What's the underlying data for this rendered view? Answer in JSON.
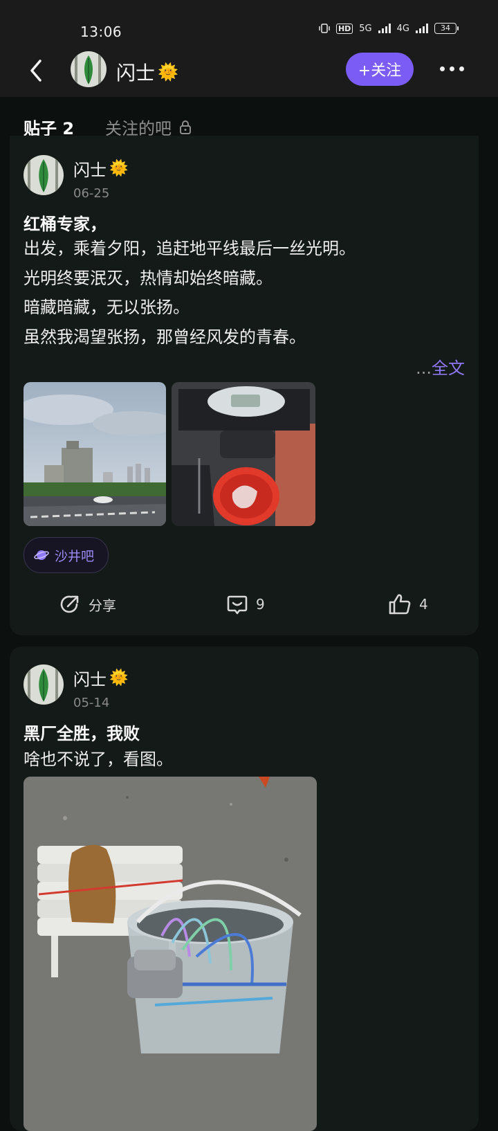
{
  "status": {
    "time": "13:06",
    "hd": "HD",
    "net1": "5G",
    "net2": "4G",
    "battery": "34"
  },
  "header": {
    "username": "闪士",
    "follow_label": "+关注"
  },
  "tabs": {
    "posts_label": "贴子 2",
    "followed_bars_label": "关注的吧"
  },
  "posts": [
    {
      "author": "闪士",
      "date": "06-25",
      "title": "红桶专家，",
      "lines": [
        "出发，乘着夕阳，追赶地平线最后一丝光明。",
        "光明终要泯灭，热情却始终暗藏。",
        "暗藏暗藏，无以张扬。",
        "虽然我渴望张扬，那曾经风发的青春。"
      ],
      "more_dots": "...",
      "more_label": "全文",
      "bar_name": "沙井吧",
      "share_label": "分享",
      "comments": "9",
      "likes": "4"
    },
    {
      "author": "闪士",
      "date": "05-14",
      "title": "黑厂全胜，我败",
      "lines": [
        "啥也不说了，看图。"
      ]
    }
  ],
  "icons": {
    "badge": "sun-emoji-badge",
    "lock": "lock-icon",
    "share": "share-icon",
    "comment": "comment-icon",
    "like": "thumbs-up-icon",
    "bar": "planet-icon"
  },
  "colors": {
    "accent": "#7b5cf5",
    "background": "#0c110f",
    "card": "#141a17"
  }
}
